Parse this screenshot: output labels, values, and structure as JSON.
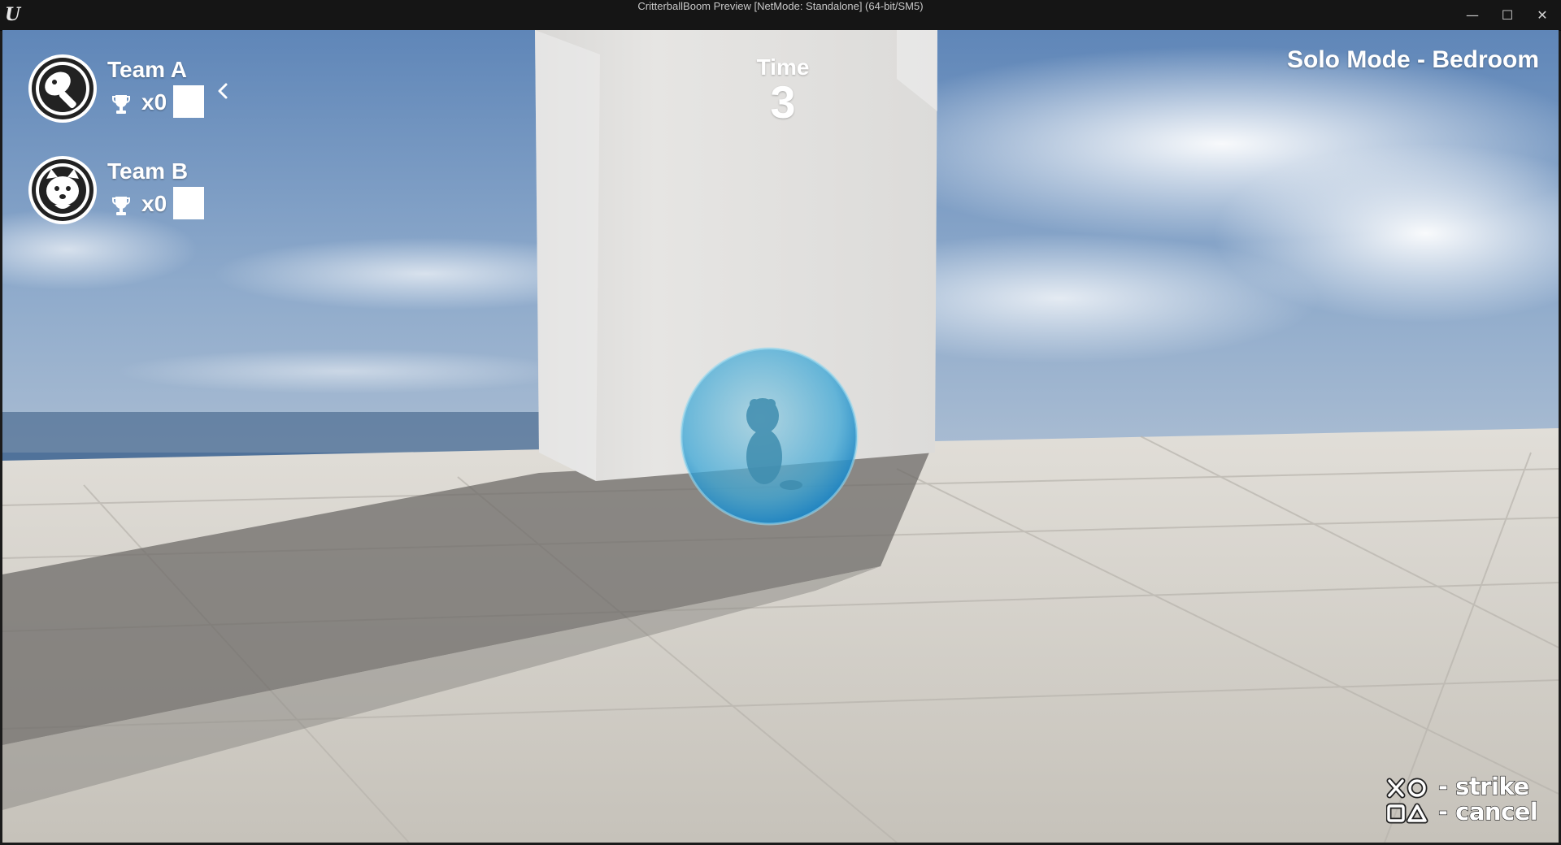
{
  "window": {
    "title": "CritterballBoom Preview [NetMode: Standalone]  (64-bit/SM5)",
    "logo_icon": "unreal-engine-logo-icon",
    "buttons": {
      "minimize": "—",
      "maximize": "☐",
      "close": "✕"
    }
  },
  "hud": {
    "teams": [
      {
        "name": "Team A",
        "emblem_icon": "mallet-emblem-icon",
        "score": "x0",
        "selected": true
      },
      {
        "name": "Team B",
        "emblem_icon": "critter-face-emblem-icon",
        "score": "x0",
        "selected": false
      }
    ],
    "time": {
      "label": "Time",
      "value": "3"
    },
    "mode": "Solo Mode - Bedroom",
    "controls": [
      {
        "icons": [
          "cross-button-icon",
          "circle-button-icon"
        ],
        "text": "- strike"
      },
      {
        "icons": [
          "square-button-icon",
          "triangle-button-icon"
        ],
        "text": "- cancel"
      }
    ]
  },
  "colors": {
    "sky": "#6d8fb8",
    "floor": "#cdcac3",
    "wall": "#e4e3e1",
    "ball": "#3fa9d8",
    "hud_text": "#ffffff"
  }
}
